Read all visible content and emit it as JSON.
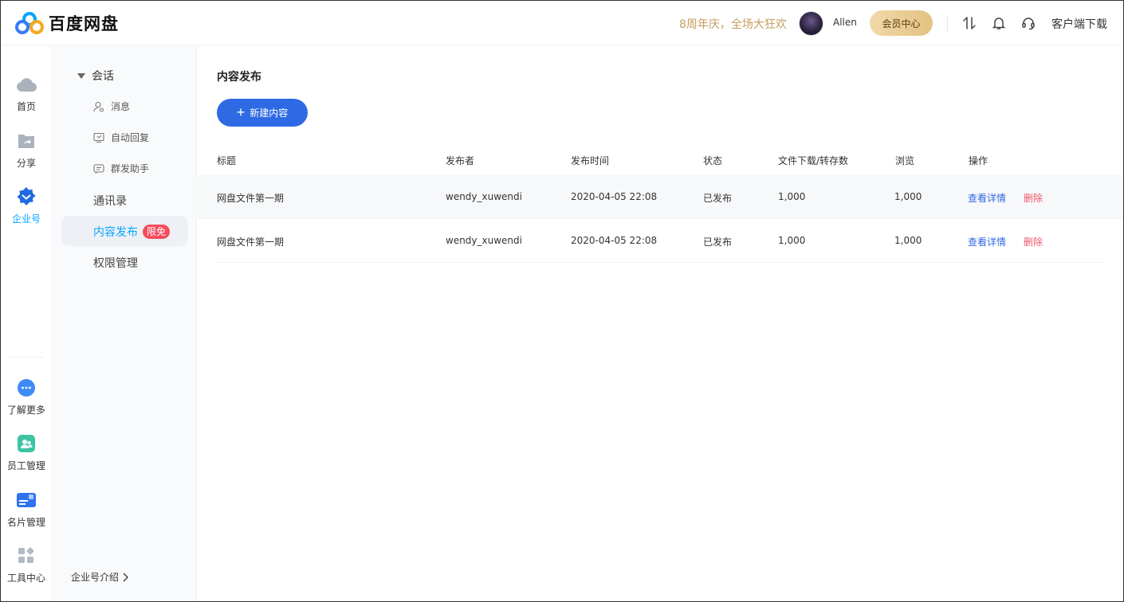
{
  "header": {
    "brand": "百度网盘",
    "promo": "8周年庆，全场大狂欢",
    "username": "Allen",
    "vip_button": "会员中心",
    "client_download": "客户端下载"
  },
  "icon_nav": {
    "top": [
      {
        "label": "首页",
        "icon": "cloud-icon"
      },
      {
        "label": "分享",
        "icon": "share-folder-icon"
      },
      {
        "label": "企业号",
        "icon": "enterprise-badge-icon",
        "active": true
      }
    ],
    "bottom": [
      {
        "label": "了解更多",
        "icon": "more-dots-icon"
      },
      {
        "label": "员工管理",
        "icon": "staff-icon"
      },
      {
        "label": "名片管理",
        "icon": "card-icon"
      },
      {
        "label": "工具中心",
        "icon": "tools-icon"
      }
    ]
  },
  "sidebar": {
    "group_label": "会话",
    "sub_items": [
      "消息",
      "自动回复",
      "群发助手"
    ],
    "contacts": "通讯录",
    "active_item": "内容发布",
    "active_badge": "限免",
    "permissions": "权限管理",
    "footer": "企业号介绍"
  },
  "main": {
    "title": "内容发布",
    "new_button": "新建内容",
    "columns": [
      "标题",
      "发布者",
      "发布时间",
      "状态",
      "文件下载/转存数",
      "浏览",
      "操作"
    ],
    "rows": [
      {
        "title": "网盘文件第一期",
        "publisher": "wendy_xuwendi",
        "time": "2020-04-05 22:08",
        "status": "已发布",
        "downloads": "1,000",
        "views": "1,000",
        "view_action": "查看详情",
        "delete_action": "删除"
      },
      {
        "title": "网盘文件第一期",
        "publisher": "wendy_xuwendi",
        "time": "2020-04-05 22:08",
        "status": "已发布",
        "downloads": "1,000",
        "views": "1,000",
        "view_action": "查看详情",
        "delete_action": "删除"
      }
    ]
  },
  "colors": {
    "accent": "#06a7ff",
    "primary_button": "#2e6ae3",
    "promo": "#c59d5f",
    "danger": "#f0586d",
    "badge": "#f64c5c"
  }
}
